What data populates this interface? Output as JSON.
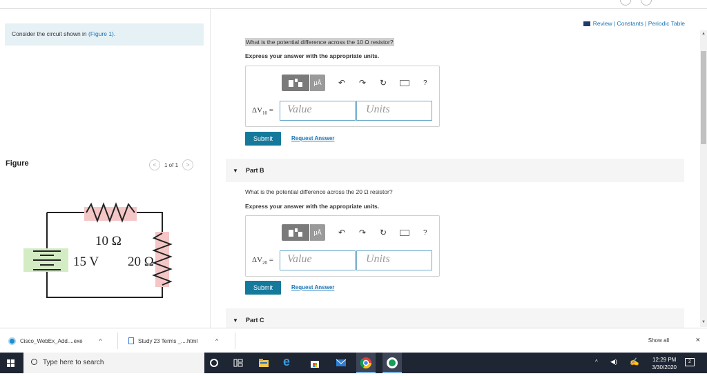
{
  "left": {
    "context_text": "Consider the circuit shown in",
    "context_link": "(Figure 1).",
    "figure_title": "Figure",
    "figure_counter": "1 of 1",
    "circuit": {
      "r1_label": "10 Ω",
      "v_label": "15 V",
      "r2_label": "20 Ω"
    }
  },
  "right": {
    "review_links": "Review | Constants | Periodic Table",
    "partA": {
      "question": "What is the potential difference across the 10 Ω resistor?",
      "express": "Express your answer with the appropriate units.",
      "var": "ΔV",
      "var_sub": "10",
      "equals": "=",
      "value_placeholder": "Value",
      "units_placeholder": "Units",
      "submit": "Submit",
      "request": "Request Answer",
      "toolbar_mu": "μÅ",
      "toolbar_help": "?"
    },
    "partB": {
      "label": "Part B",
      "question": "What is the potential difference across the 20 Ω resistor?",
      "express": "Express your answer with the appropriate units.",
      "var": "ΔV",
      "var_sub": "20",
      "equals": "=",
      "value_placeholder": "Value",
      "units_placeholder": "Units",
      "submit": "Submit",
      "request": "Request Answer",
      "toolbar_mu": "μÅ",
      "toolbar_help": "?"
    },
    "partC": {
      "label": "Part C"
    }
  },
  "downloads": {
    "item1": "Cisco_WebEx_Add....exe",
    "item2": "Study 23 Terms _....html",
    "show_all": "Show all",
    "close": "×"
  },
  "taskbar": {
    "search_placeholder": "Type here to search",
    "time": "12:29 PM",
    "date": "3/30/2020",
    "notification_count": "2"
  },
  "colors": {
    "accent": "#15799c",
    "link": "#1a75b4",
    "resistor_fill": "#f4c6c6",
    "battery_fill": "#d4ecc4"
  }
}
